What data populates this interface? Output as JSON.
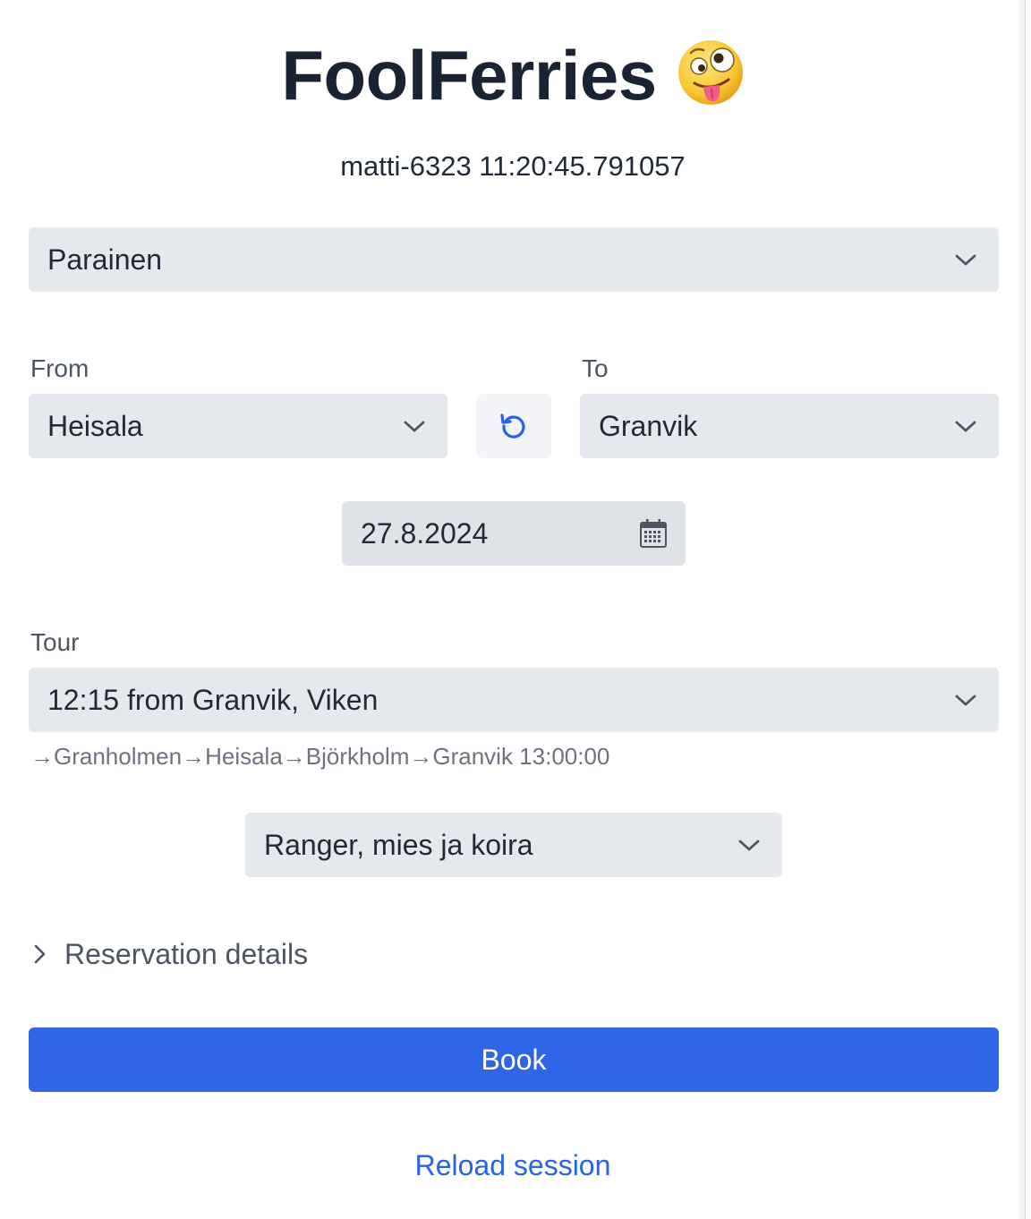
{
  "app": {
    "title": "FoolFerries",
    "title_emoji": "zany-face-emoji",
    "session_text": "matti-6323 11:20:45.791057"
  },
  "area_select": {
    "value": "Parainen"
  },
  "from": {
    "label": "From",
    "value": "Heisala"
  },
  "to": {
    "label": "To",
    "value": "Granvik"
  },
  "swap_button": {
    "icon": "swap-refresh-icon",
    "color": "#2563eb"
  },
  "date": {
    "value": "27.8.2024",
    "icon": "calendar-icon"
  },
  "tour": {
    "label": "Tour",
    "value": "12:15 from Granvik, Viken",
    "route": "→Granholmen→Heisala→Björkholm→Granvik 13:00:00"
  },
  "vehicle_select": {
    "value": "Ranger, mies ja koira"
  },
  "reservation_details": {
    "label": "Reservation details",
    "expanded": false
  },
  "book_button": {
    "label": "Book",
    "color": "#2f66e8"
  },
  "reload_link": {
    "label": "Reload session",
    "color": "#2563eb"
  }
}
